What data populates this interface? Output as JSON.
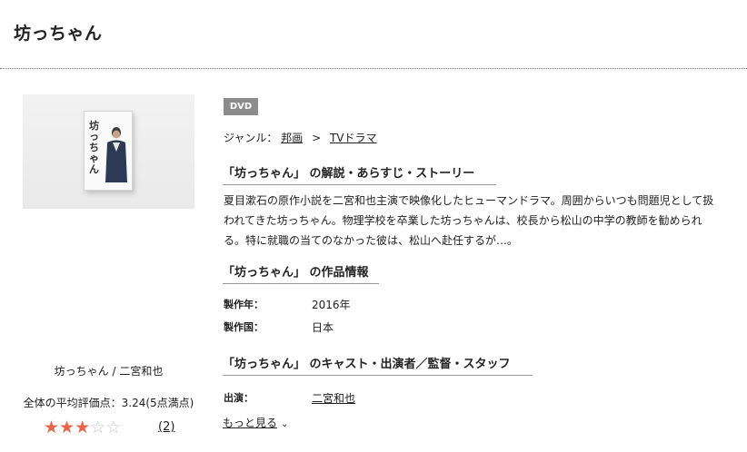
{
  "page": {
    "title": "坊っちゃん"
  },
  "left": {
    "cover_alt_text": "坊っちゃん",
    "name_line": "坊っちゃん / 二宮和也",
    "rating_line": "全体の平均評価点：3.24(5点満点)",
    "rating_value": 3.24,
    "rating_max": 5,
    "review_count": "(2)"
  },
  "right": {
    "badge": "DVD",
    "genre": {
      "label": "ジャンル：",
      "items": [
        "邦画",
        "TVドラマ"
      ],
      "separator": ">"
    },
    "story_heading": "「坊っちゃん」 の解説・あらすじ・ストーリー",
    "synopsis": "夏目漱石の原作小説を二宮和也主演で映像化したヒューマンドラマ。周囲からいつも問題児として扱われてきた坊っちゃん。物理学校を卒業した坊っちゃんは、校長から松山の中学の教師を勧められる。特に就職の当てのなかった彼は、松山へ赴任するが…。",
    "info_heading": "「坊っちゃん」 の作品情報",
    "info": [
      {
        "label": "製作年：",
        "value": "2016年"
      },
      {
        "label": "製作国：",
        "value": "日本"
      }
    ],
    "cast_heading": "「坊っちゃん」 のキャスト・出演者／監督・スタッフ",
    "cast": [
      {
        "label": "出演：",
        "value": "二宮和也"
      }
    ],
    "more_label": "もっと見る"
  },
  "colors": {
    "star_filled": "#e8654a",
    "star_empty": "#c8c8c8",
    "badge_bg": "#8c8c8c"
  },
  "icons": {
    "star": "star-icon",
    "chevron": "chevron-down-icon"
  }
}
